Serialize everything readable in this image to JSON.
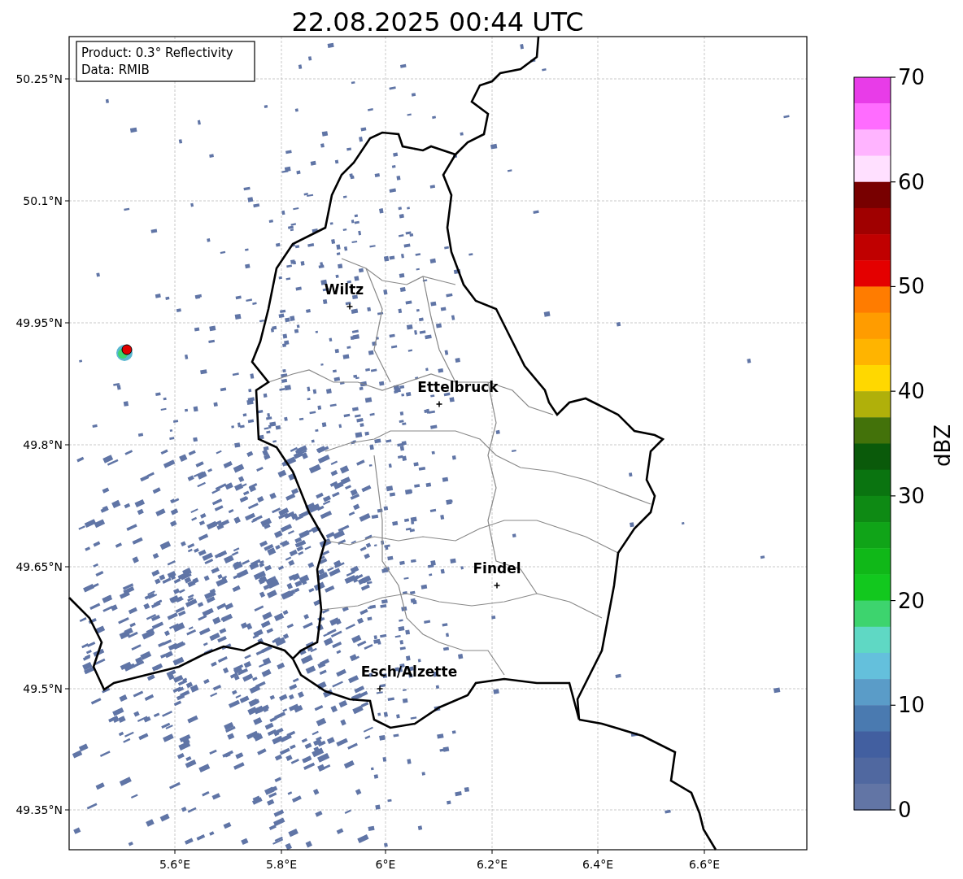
{
  "title": "22.08.2025 00:44 UTC",
  "info_box": [
    "Product: 0.3° Reflectivity",
    "Data: RMIB"
  ],
  "lat_labels": [
    "50.25°N",
    "50.1°N",
    "49.95°N",
    "49.8°N",
    "49.65°N",
    "49.5°N",
    "49.35°N"
  ],
  "lon_labels": [
    "5.6°E",
    "5.8°E",
    "6°E",
    "6.2°E",
    "6.4°E",
    "6.6°E"
  ],
  "cities": [
    {
      "name": "Wiltz"
    },
    {
      "name": "Ettelbruck"
    },
    {
      "name": "Findel"
    },
    {
      "name": "Esch/Alzette"
    }
  ],
  "colorbar": {
    "label": "dBZ",
    "ticks": [
      "70",
      "60",
      "50",
      "40",
      "30",
      "20",
      "10",
      "0"
    ],
    "bins": [
      {
        "color": "#e83ce8"
      },
      {
        "color": "#ff6cff"
      },
      {
        "color": "#ffb4ff"
      },
      {
        "color": "#ffe0ff"
      },
      {
        "color": "#780000"
      },
      {
        "color": "#a00000"
      },
      {
        "color": "#c00000"
      },
      {
        "color": "#e40000"
      },
      {
        "color": "#ff7c00"
      },
      {
        "color": "#ff9c00"
      },
      {
        "color": "#ffb400"
      },
      {
        "color": "#ffd800"
      },
      {
        "color": "#b0b00a"
      },
      {
        "color": "#43720a"
      },
      {
        "color": "#0a5a0a"
      },
      {
        "color": "#0a7410"
      },
      {
        "color": "#0e8a14"
      },
      {
        "color": "#10a418"
      },
      {
        "color": "#10b818"
      },
      {
        "color": "#12c81e"
      },
      {
        "color": "#3dd46e"
      },
      {
        "color": "#5fd8c4"
      },
      {
        "color": "#64c0dc"
      },
      {
        "color": "#5a9cc8"
      },
      {
        "color": "#4a7ab0"
      },
      {
        "color": "#425fa0"
      },
      {
        "color": "#5068a0"
      },
      {
        "color": "#6275a5"
      }
    ]
  }
}
